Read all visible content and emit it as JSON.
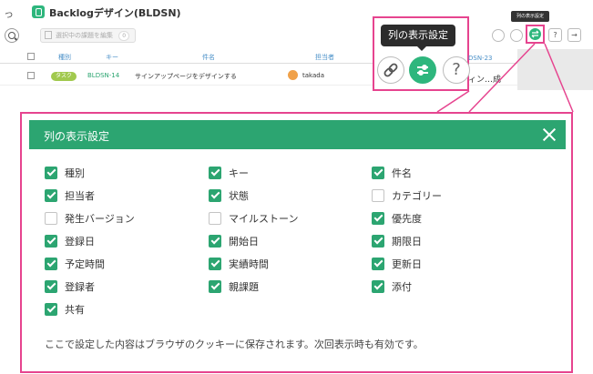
{
  "header": {
    "project_title": "Backlogデザイン(BLDSN)",
    "back_glyph": "っ"
  },
  "toolbar": {
    "bulk_edit_label": "選択中の課題を編集",
    "bulk_edit_count": "0",
    "small_tooltip": "列の表示設定",
    "help_glyph": "?",
    "collapse_glyph": "→"
  },
  "table": {
    "headers": [
      "種別",
      "キー",
      "件名",
      "担当者"
    ],
    "row": {
      "type_badge": "タスク",
      "key": "BLDSN-14",
      "title": "サインアップページをデザインする",
      "assignee": "takada"
    }
  },
  "zoom_callout": {
    "tooltip": "列の表示設定",
    "help_glyph": "?",
    "behind_key": "DSN-23",
    "behind_text": "ィン…成"
  },
  "dialog": {
    "title": "列の表示設定",
    "options": [
      {
        "label": "種別",
        "checked": true
      },
      {
        "label": "キー",
        "checked": true
      },
      {
        "label": "件名",
        "checked": true
      },
      {
        "label": "担当者",
        "checked": true
      },
      {
        "label": "状態",
        "checked": true
      },
      {
        "label": "カテゴリー",
        "checked": false
      },
      {
        "label": "発生バージョン",
        "checked": false
      },
      {
        "label": "マイルストーン",
        "checked": false
      },
      {
        "label": "優先度",
        "checked": true
      },
      {
        "label": "登録日",
        "checked": true
      },
      {
        "label": "開始日",
        "checked": true
      },
      {
        "label": "期限日",
        "checked": true
      },
      {
        "label": "予定時間",
        "checked": true
      },
      {
        "label": "実績時間",
        "checked": true
      },
      {
        "label": "更新日",
        "checked": true
      },
      {
        "label": "登録者",
        "checked": true
      },
      {
        "label": "親課題",
        "checked": true
      },
      {
        "label": "添付",
        "checked": true
      },
      {
        "label": "共有",
        "checked": true
      }
    ],
    "note": "ここで設定した内容はブラウザのクッキーに保存されます。次回表示時も有効です。"
  },
  "colors": {
    "accent_green": "#2ca571",
    "highlight_pink": "#e6448f",
    "task_badge": "#a1c94e"
  },
  "icons": [
    "search-icon",
    "pen-icon",
    "link-icon",
    "column-settings-icon",
    "help-icon",
    "close-icon",
    "checkbox-icon"
  ]
}
